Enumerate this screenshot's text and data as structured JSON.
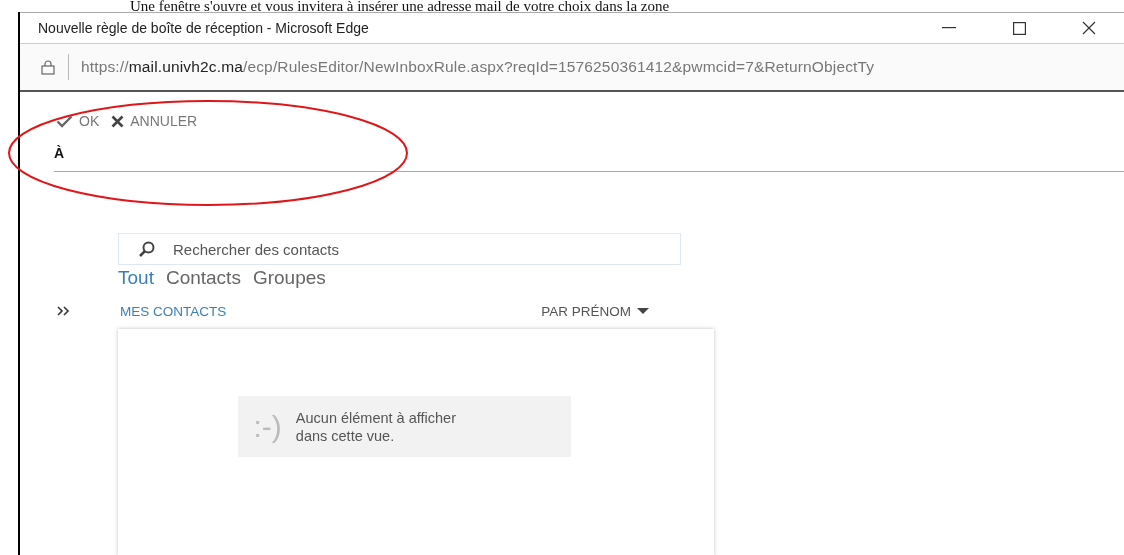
{
  "document_text": "Une fenêtre s'ouvre et vous invitera à insérer une adresse mail de votre choix dans la zone",
  "window": {
    "title": "Nouvelle règle de boîte de réception - Microsoft Edge"
  },
  "address_bar": {
    "url": "https://**mail.univh2c.ma**/ecp/RulesEditor/NewInboxRule.aspx?reqId=1576250361412&pwmcid=7&ReturnObjectTy"
  },
  "toolbar": [
    {
      "kind": "ok",
      "label": "OK"
    },
    {
      "kind": "cancel",
      "label": "ANNULER"
    }
  ],
  "recipient_field": {
    "label": "À"
  },
  "search": {
    "placeholder": "Rechercher des contacts"
  },
  "tabs": [
    {
      "label": "Tout",
      "selected": true
    },
    {
      "label": "Contacts",
      "selected": false
    },
    {
      "label": "Groupes",
      "selected": false
    }
  ],
  "list_header": {
    "title": "MES CONTACTS",
    "sort": "PAR PRÉNOM"
  },
  "empty_state": {
    "emoticon": ":-)",
    "message": "Aucun élément à afficher dans cette vue."
  }
}
